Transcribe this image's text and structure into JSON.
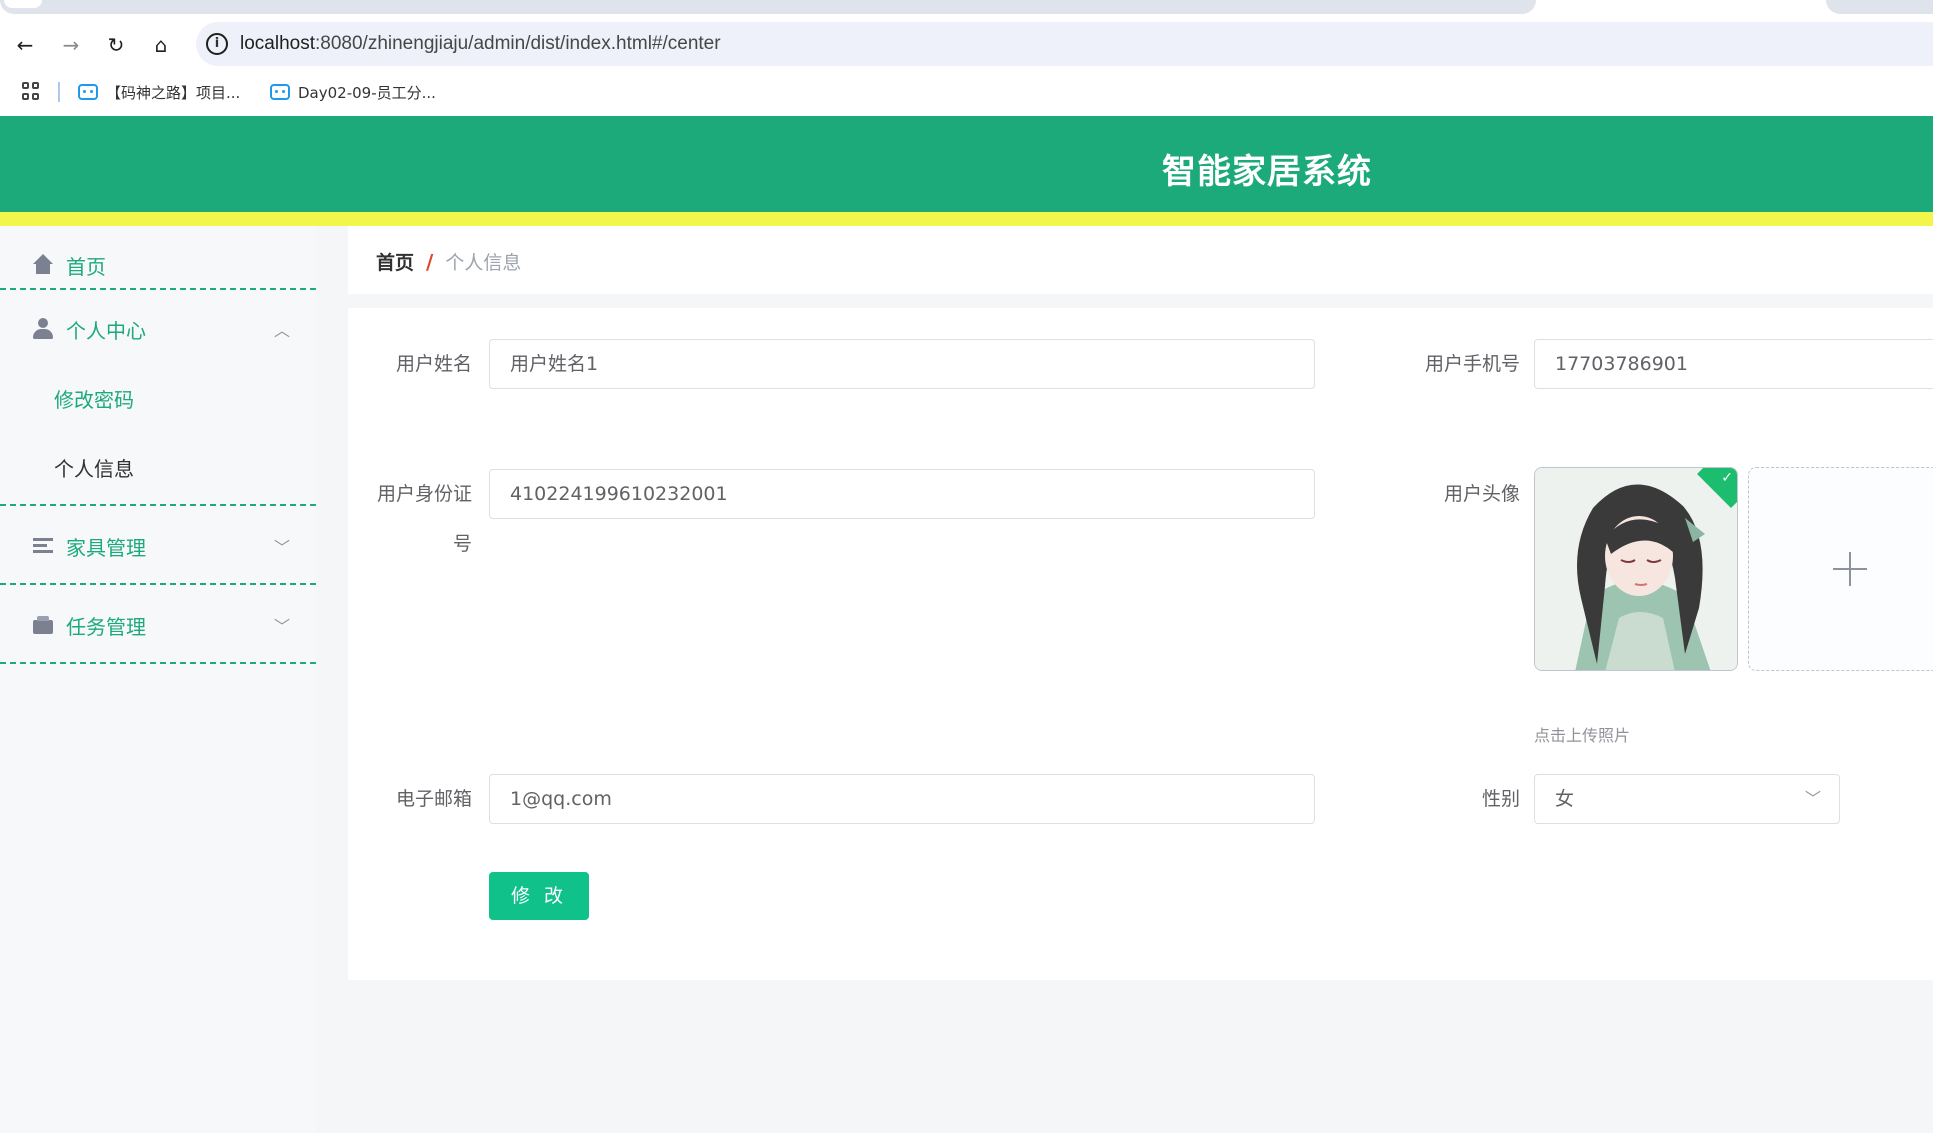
{
  "browser": {
    "url_host": "localhost",
    "url_path": ":8080/zhinengjiaju/admin/dist/index.html#/center",
    "bookmarks": [
      {
        "label": "【码神之路】项目..."
      },
      {
        "label": "Day02-09-员工分..."
      }
    ],
    "icons": {
      "back": "arrow-left-icon",
      "forward": "arrow-right-icon",
      "reload": "reload-icon",
      "home": "home-icon",
      "site_info": "info-icon",
      "apps": "apps-grid-icon",
      "bookmark": "bilibili-icon"
    }
  },
  "header": {
    "title": "智能家居系统",
    "bg_color": "#1daa7a",
    "accent_bar_color": "#f3f64a"
  },
  "sidebar": {
    "items": [
      {
        "label": "首页",
        "icon": "home-icon"
      },
      {
        "label": "个人中心",
        "icon": "user-icon",
        "expanded": true,
        "children": [
          {
            "label": "修改密码",
            "active": false
          },
          {
            "label": "个人信息",
            "active": true
          }
        ]
      },
      {
        "label": "家具管理",
        "icon": "list-icon",
        "expanded": false
      },
      {
        "label": "任务管理",
        "icon": "wallet-icon",
        "expanded": false
      }
    ],
    "active_color": "#1daa7a"
  },
  "breadcrumb": {
    "home": "首页",
    "separator": "/",
    "current": "个人信息"
  },
  "form": {
    "username_label": "用户姓名",
    "username_value": "用户姓名1",
    "phone_label": "用户手机号",
    "phone_value": "17703786901",
    "idcard_label": "用户身份证号",
    "idcard_value": "410224199610232001",
    "avatar_label": "用户头像",
    "upload_tip": "点击上传照片",
    "email_label": "电子邮箱",
    "email_value": "1@qq.com",
    "gender_label": "性别",
    "gender_value": "女",
    "submit_label": "修 改",
    "submit_color": "#10c28a"
  }
}
